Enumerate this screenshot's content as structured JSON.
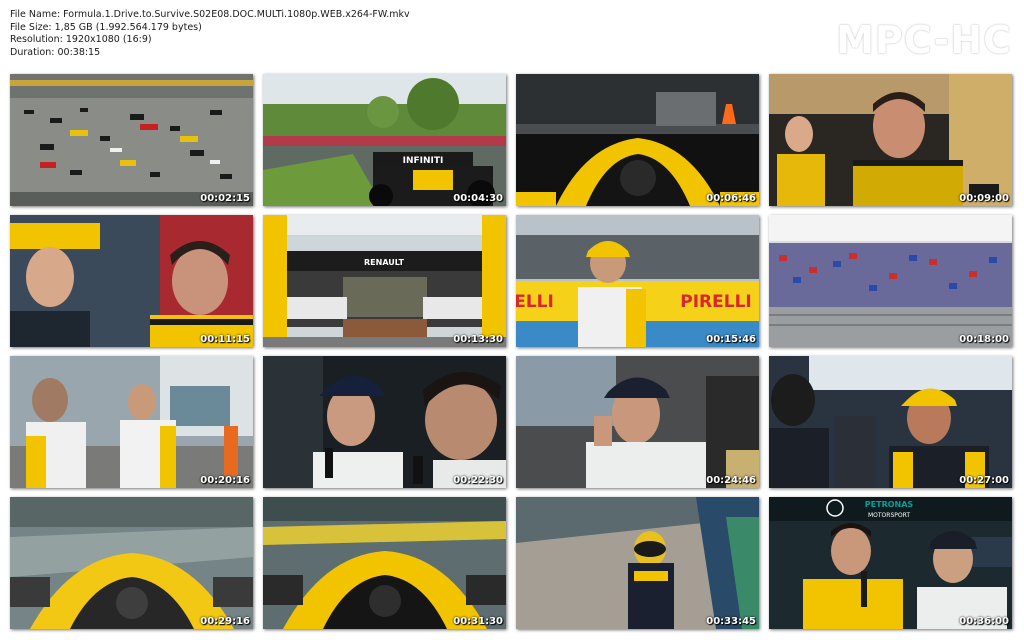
{
  "file_info": {
    "file_name": "File Name: Formula.1.Drive.to.Survive.S02E08.DOC.MULTi.1080p.WEB.x264-FW.mkv",
    "file_size": "File Size: 1,85 GB (1.992.564.179 bytes)",
    "resolution": "Resolution: 1920x1080 (16:9)",
    "duration": "Duration: 00:38:15"
  },
  "logo": "MPC-HC",
  "thumbnails": [
    {
      "timestamp": "00:02:15",
      "scene": "aerial-grid-icon"
    },
    {
      "timestamp": "00:04:30",
      "scene": "infiniti-car-icon"
    },
    {
      "timestamp": "00:06:46",
      "scene": "cockpit-onboard-icon"
    },
    {
      "timestamp": "00:09:00",
      "scene": "man-in-car-icon"
    },
    {
      "timestamp": "00:11:15",
      "scene": "two-men-talking-icon"
    },
    {
      "timestamp": "00:13:30",
      "scene": "renault-hospitality-icon"
    },
    {
      "timestamp": "00:15:46",
      "scene": "driver-pirelli-icon"
    },
    {
      "timestamp": "00:18:00",
      "scene": "grandstand-crowd-icon"
    },
    {
      "timestamp": "00:20:16",
      "scene": "team-walking-icon"
    },
    {
      "timestamp": "00:22:30",
      "scene": "interview-icon"
    },
    {
      "timestamp": "00:24:46",
      "scene": "man-in-car-seat-icon"
    },
    {
      "timestamp": "00:27:00",
      "scene": "driver-crowd-icon"
    },
    {
      "timestamp": "00:29:16",
      "scene": "rain-onboard-icon"
    },
    {
      "timestamp": "00:31:30",
      "scene": "rain-onboard-2-icon"
    },
    {
      "timestamp": "00:33:45",
      "scene": "driver-gravel-icon"
    },
    {
      "timestamp": "00:36:00",
      "scene": "press-conference-icon"
    }
  ],
  "overlay_text": {
    "infiniti": "INFINITI",
    "renault": "RENAULT",
    "pirelli": "PIRELLI",
    "petronas": "PETRONAS",
    "motorsport": "MOTORSPORT"
  },
  "colors": {
    "renault_yellow": "#f2c400",
    "pirelli_yellow": "#f6d11a",
    "pirelli_red": "#d8272d",
    "petronas_teal": "#00a19b"
  }
}
